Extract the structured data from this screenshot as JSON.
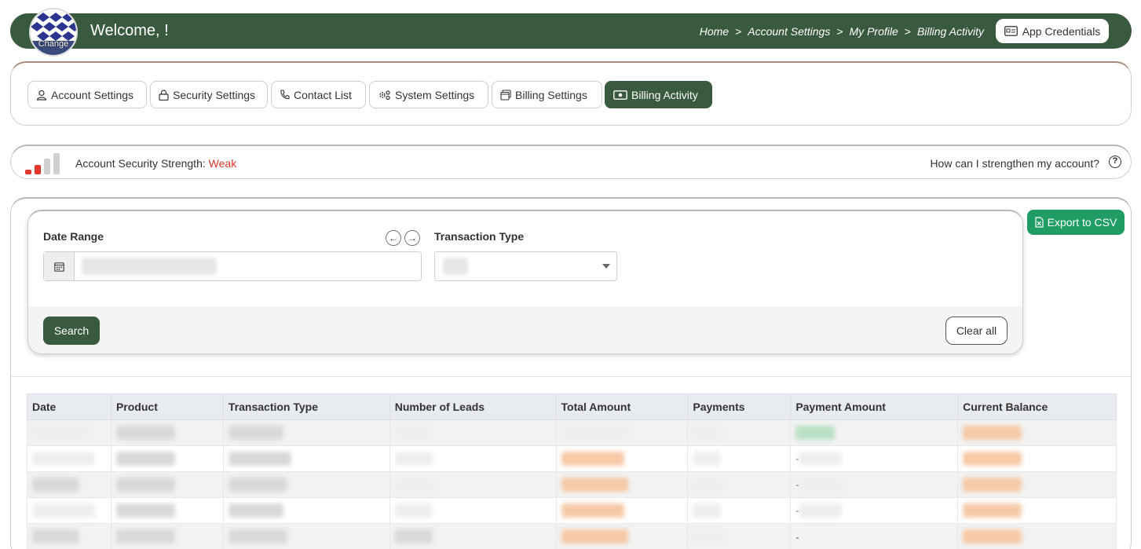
{
  "header": {
    "avatar_label": "Change",
    "welcome": "Welcome, !",
    "breadcrumb": [
      "Home",
      "Account Settings",
      "My Profile",
      "Billing Activity"
    ],
    "breadcrumb_sep": ">",
    "credentials_label": "App Credentials"
  },
  "tabs": [
    {
      "label": "Account Settings",
      "icon": "user-icon"
    },
    {
      "label": "Security Settings",
      "icon": "lock-icon"
    },
    {
      "label": "Contact List",
      "icon": "phone-icon"
    },
    {
      "label": "System Settings",
      "icon": "gears-icon"
    },
    {
      "label": "Billing Settings",
      "icon": "window-icon"
    },
    {
      "label": "Billing Activity",
      "icon": "cash-icon",
      "active": true
    }
  ],
  "security": {
    "label": "Account Security Strength:",
    "level": "Weak",
    "help": "How can I strengthen my account?",
    "help_icon": "?"
  },
  "filters": {
    "date_range_label": "Date Range",
    "transaction_type_label": "Transaction Type",
    "prev_arrow": "←",
    "next_arrow": "→",
    "search_label": "Search",
    "clear_label": "Clear all",
    "export_label": "Export to CSV"
  },
  "table": {
    "headers": [
      "Date",
      "Product",
      "Transaction Type",
      "Number of Leads",
      "Total Amount",
      "Payments",
      "Payment Amount",
      "Current Balance"
    ],
    "dash": "-"
  },
  "colors": {
    "brand": "#3a5a40",
    "export": "#1f9d64",
    "weak": "#e0362f"
  }
}
